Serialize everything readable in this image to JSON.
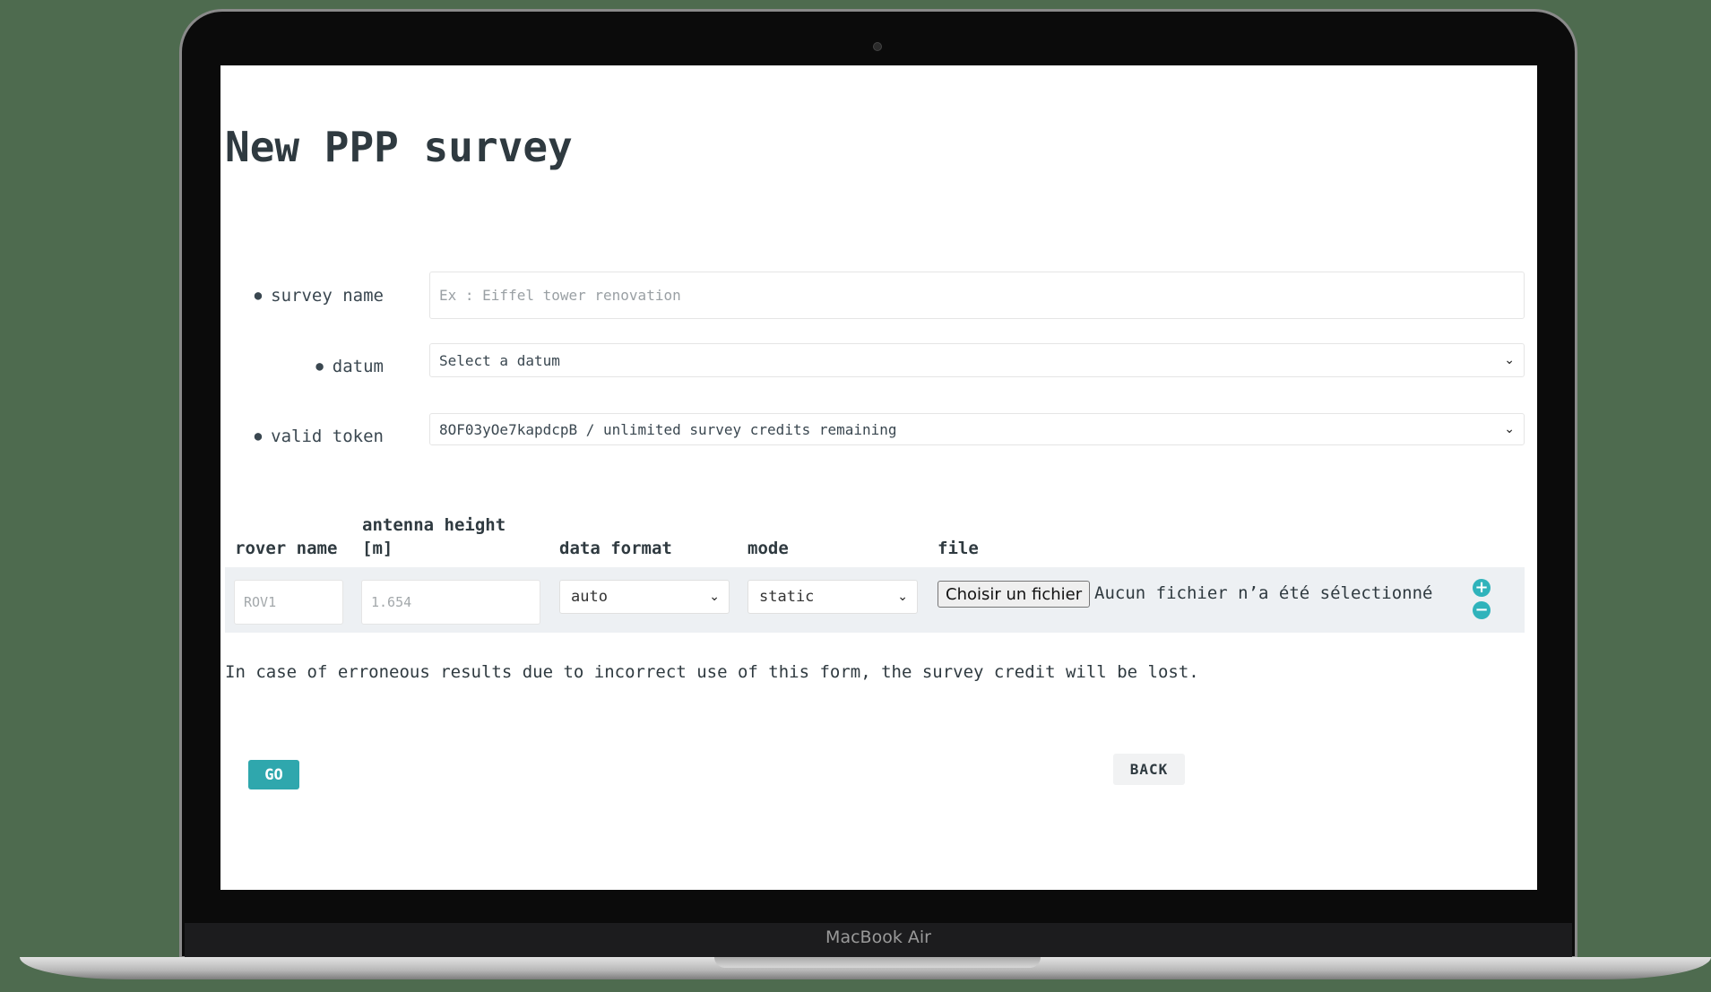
{
  "device": {
    "brand_label": "MacBook Air"
  },
  "page": {
    "title": "New PPP survey"
  },
  "form": {
    "survey_name": {
      "label": "survey name",
      "placeholder": "Ex : Eiffel tower renovation"
    },
    "datum": {
      "label": "datum",
      "selected": "Select a datum"
    },
    "valid_token": {
      "label": "valid token",
      "selected": "8OF03yOe7kapdcpB / unlimited survey credits remaining"
    }
  },
  "rovers": {
    "headers": {
      "rover_name": "rover name",
      "antenna_height_line1": "antenna height",
      "antenna_height_line2": "[m]",
      "data_format": "data format",
      "mode": "mode",
      "file": "file"
    },
    "row": {
      "rover_name_placeholder": "ROV1",
      "antenna_height_placeholder": "1.654",
      "data_format": "auto",
      "mode": "static",
      "file_button": "Choisir un fichier",
      "file_status": "Aucun fichier n’a été sélectionné",
      "add_symbol": "+",
      "remove_symbol": "−"
    }
  },
  "notice": "In case of erroneous results due to incorrect use of this form, the survey credit will be lost.",
  "actions": {
    "go": "GO",
    "back": "BACK"
  },
  "colors": {
    "accent": "#2fa7ad",
    "round_button": "#2fb3bb",
    "text": "#2f3a40"
  },
  "icons": {
    "bullet": "eye-icon",
    "dropdown": "chevron-down-icon",
    "add": "plus-circle-icon",
    "remove": "minus-circle-icon"
  }
}
